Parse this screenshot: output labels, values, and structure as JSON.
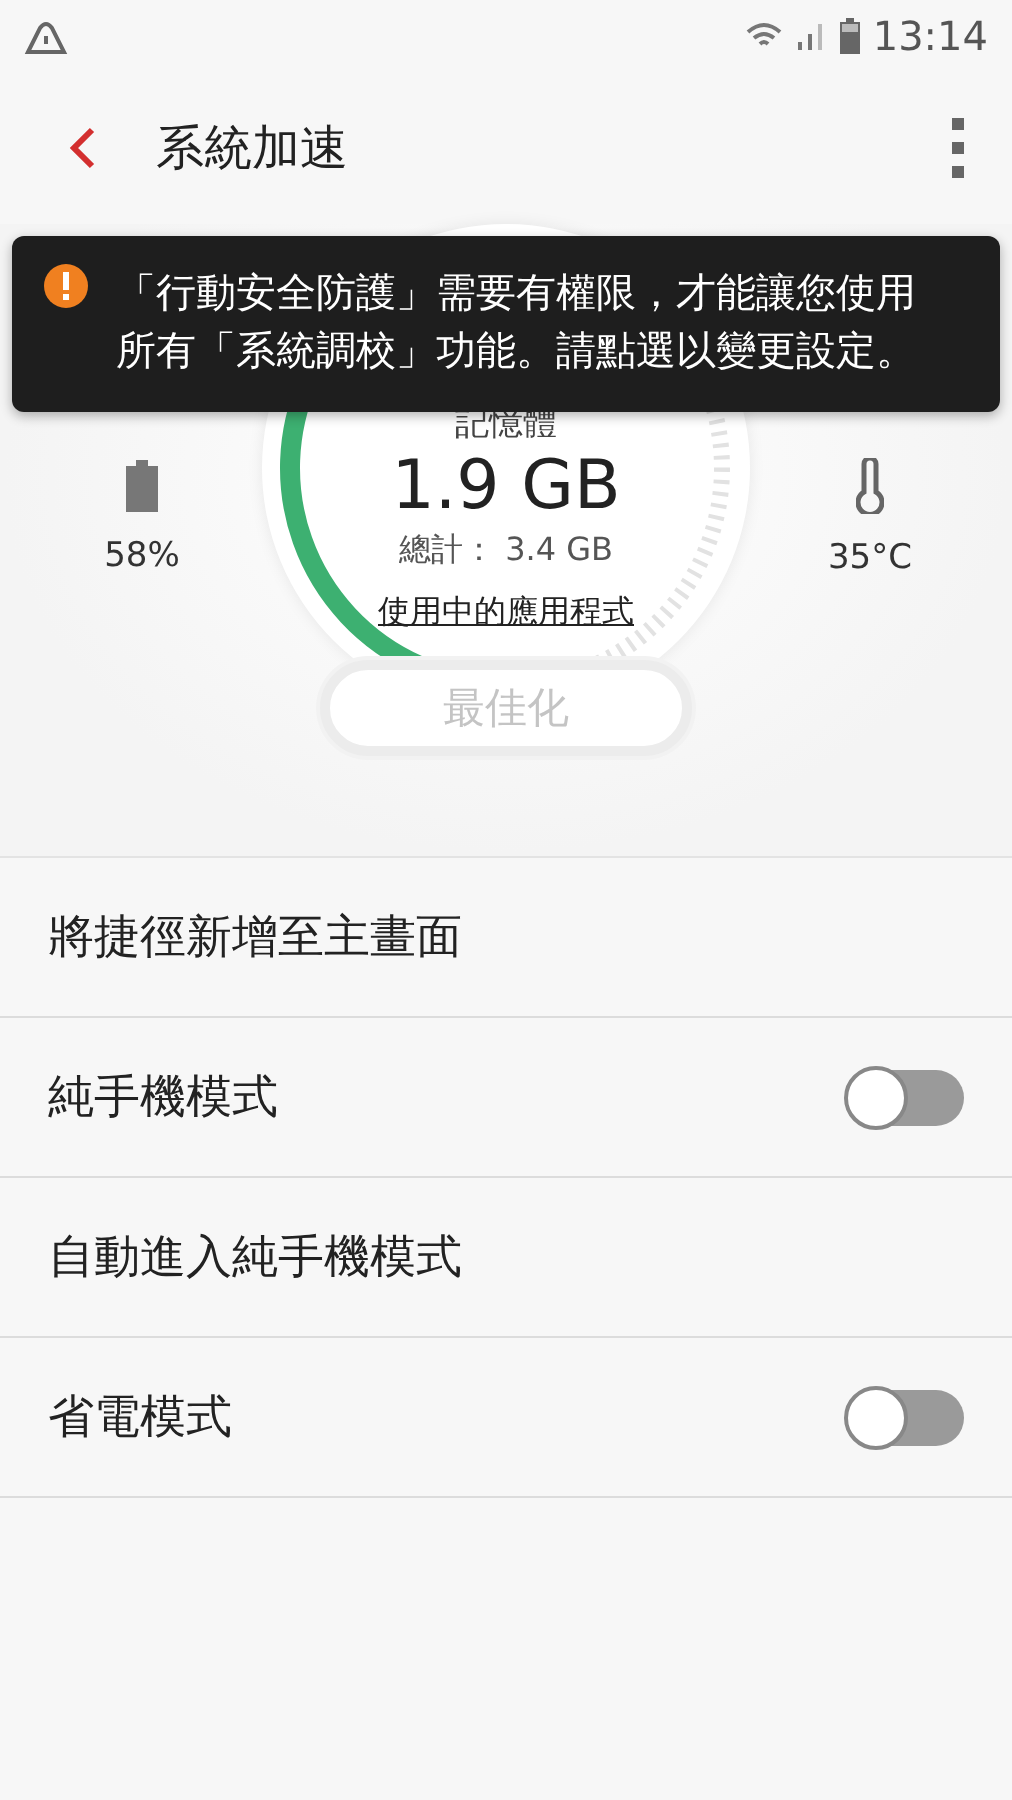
{
  "status_bar": {
    "time": "13:14"
  },
  "app_bar": {
    "title": "系統加速"
  },
  "banner": {
    "message": "「行動安全防護」需要有權限，才能讓您使用所有「系統調校」功能。請點選以變更設定。"
  },
  "memory": {
    "label": "記憶體",
    "used": "1.9 GB",
    "total": "總計： 3.4 GB",
    "link": "使用中的應用程式"
  },
  "battery": {
    "reading": "58%"
  },
  "temperature": {
    "reading": "35°C"
  },
  "optimize_button": {
    "label": "最佳化",
    "disabled": true
  },
  "settings": [
    {
      "kind": "plain",
      "label": "將捷徑新增至主畫面"
    },
    {
      "kind": "toggle",
      "label": "純手機模式",
      "on": false
    },
    {
      "kind": "plain",
      "label": "自動進入純手機模式"
    },
    {
      "kind": "toggle",
      "label": "省電模式",
      "on": false
    }
  ]
}
